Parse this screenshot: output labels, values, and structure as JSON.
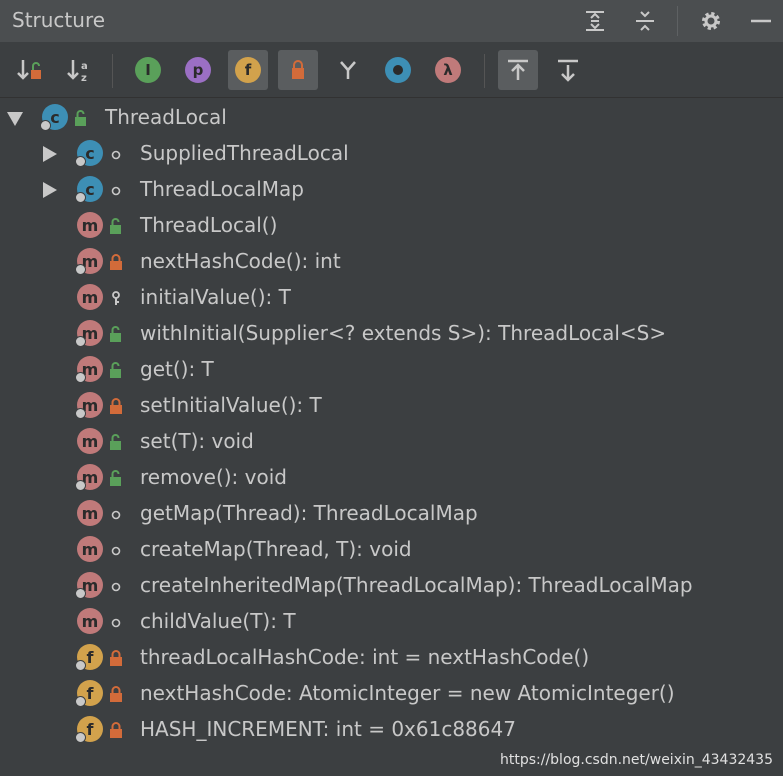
{
  "panel": {
    "title": "Structure"
  },
  "toolbar": {
    "tools": [
      {
        "name": "sort-by-visibility",
        "icon": "sort-visibility-icon",
        "active": false
      },
      {
        "name": "sort-alphabetically",
        "icon": "sort-alpha-icon",
        "active": false
      },
      {
        "name": "show-inherited",
        "icon": "inherited-icon",
        "active": false
      },
      {
        "name": "show-properties",
        "icon": "property-icon",
        "active": false
      },
      {
        "name": "show-fields",
        "icon": "field-icon",
        "active": true
      },
      {
        "name": "show-non-public",
        "icon": "lock-icon",
        "active": true
      },
      {
        "name": "show-anonymous",
        "icon": "anonymous-icon",
        "active": false
      },
      {
        "name": "show-interfaces",
        "icon": "circle-icon",
        "active": false
      },
      {
        "name": "show-lambdas",
        "icon": "lambda-icon",
        "active": false
      },
      {
        "name": "autoscroll-to-source",
        "icon": "autoscroll-to-icon",
        "active": true
      },
      {
        "name": "autoscroll-from-source",
        "icon": "autoscroll-from-icon",
        "active": false
      }
    ]
  },
  "colors": {
    "method": "#c07a7a",
    "class": "#3d8fb5",
    "field": "#d2a24c",
    "public": "#5aa05a",
    "private": "#d26b3a"
  },
  "tree": [
    {
      "label": "ThreadLocal",
      "kind": "c",
      "vis": "public",
      "arrow": "down",
      "depth": 0
    },
    {
      "label": "SuppliedThreadLocal",
      "kind": "c",
      "vis": "package",
      "arrow": "right",
      "depth": 1
    },
    {
      "label": "ThreadLocalMap",
      "kind": "c",
      "vis": "package",
      "arrow": "right",
      "depth": 1
    },
    {
      "label": "ThreadLocal()",
      "kind": "m",
      "vis": "public",
      "arrow": "",
      "depth": 1
    },
    {
      "label": "nextHashCode(): int",
      "kind": "m",
      "vis": "private",
      "arrow": "",
      "depth": 1
    },
    {
      "label": "initialValue(): T",
      "kind": "m",
      "vis": "protected",
      "arrow": "",
      "depth": 1
    },
    {
      "label": "withInitial(Supplier<? extends S>): ThreadLocal<S>",
      "kind": "m",
      "vis": "public",
      "arrow": "",
      "depth": 1
    },
    {
      "label": "get(): T",
      "kind": "m",
      "vis": "public",
      "arrow": "",
      "depth": 1
    },
    {
      "label": "setInitialValue(): T",
      "kind": "m",
      "vis": "private",
      "arrow": "",
      "depth": 1
    },
    {
      "label": "set(T): void",
      "kind": "m",
      "vis": "public",
      "arrow": "",
      "depth": 1
    },
    {
      "label": "remove(): void",
      "kind": "m",
      "vis": "public",
      "arrow": "",
      "depth": 1
    },
    {
      "label": "getMap(Thread): ThreadLocalMap",
      "kind": "m",
      "vis": "package",
      "arrow": "",
      "depth": 1
    },
    {
      "label": "createMap(Thread, T): void",
      "kind": "m",
      "vis": "package",
      "arrow": "",
      "depth": 1
    },
    {
      "label": "createInheritedMap(ThreadLocalMap): ThreadLocalMap",
      "kind": "m",
      "vis": "package",
      "arrow": "",
      "depth": 1
    },
    {
      "label": "childValue(T): T",
      "kind": "m",
      "vis": "package",
      "arrow": "",
      "depth": 1
    },
    {
      "label": "threadLocalHashCode: int = nextHashCode()",
      "kind": "f",
      "vis": "private",
      "arrow": "",
      "depth": 1
    },
    {
      "label": "nextHashCode: AtomicInteger = new AtomicInteger()",
      "kind": "f",
      "vis": "private",
      "arrow": "",
      "depth": 1
    },
    {
      "label": "HASH_INCREMENT: int = 0x61c88647",
      "kind": "f",
      "vis": "private",
      "arrow": "",
      "depth": 1
    }
  ],
  "watermark": "https://blog.csdn.net/weixin_43432435"
}
